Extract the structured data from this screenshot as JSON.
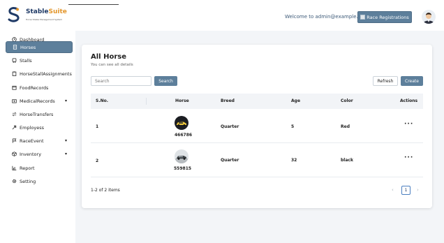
{
  "brand": {
    "name_part1": "Stable",
    "name_part2": "Suite",
    "tagline": "Horse Stable Management System"
  },
  "header": {
    "welcome_text": "Welcome to admin@example.com",
    "race_button_label": "Race Registrations"
  },
  "sidebar": {
    "items": [
      {
        "label": "Dashboard",
        "icon": "clock-icon",
        "active": false,
        "expandable": false
      },
      {
        "label": "Horses",
        "icon": "document-icon",
        "active": true,
        "expandable": false
      },
      {
        "label": "Stalls",
        "icon": "bus-icon",
        "active": false,
        "expandable": false
      },
      {
        "label": "HorseStallAssignments",
        "icon": "clipboard-icon",
        "active": false,
        "expandable": false
      },
      {
        "label": "FoodRecords",
        "icon": "calendar-icon",
        "active": false,
        "expandable": false
      },
      {
        "label": "MedicalRecords",
        "icon": "medkit-icon",
        "active": false,
        "expandable": true
      },
      {
        "label": "HorseTransfers",
        "icon": "transfer-icon",
        "active": false,
        "expandable": false
      },
      {
        "label": "Employess",
        "icon": "tools-icon",
        "active": false,
        "expandable": false
      },
      {
        "label": "RaceEvent",
        "icon": "flag-icon",
        "active": false,
        "expandable": true
      },
      {
        "label": "Inventory",
        "icon": "box-icon",
        "active": false,
        "expandable": true
      },
      {
        "label": "Report",
        "icon": "chart-icon",
        "active": false,
        "expandable": false
      },
      {
        "label": "Setting",
        "icon": "gear-icon",
        "active": false,
        "expandable": false
      }
    ]
  },
  "main": {
    "title": "All Horse",
    "subtitle": "You can see all details",
    "search_placeholder": "Search",
    "search_button": "Search",
    "refresh_button": "Refresh",
    "create_button": "Create",
    "table": {
      "headers": [
        "S.No.",
        "Horse",
        "Breed",
        "Age",
        "Color",
        "Actions"
      ],
      "rows": [
        {
          "sno": "1",
          "horse": "466786",
          "breed": "Quarter",
          "age": "5",
          "color": "Red",
          "actions": "···"
        },
        {
          "sno": "2",
          "horse": "559815",
          "breed": "Quarter",
          "age": "32",
          "color": "black",
          "actions": "···"
        }
      ]
    },
    "pagination": {
      "info": "1-2 of 2 items",
      "current_page": "1",
      "prev": "‹",
      "next": "›"
    }
  },
  "colors": {
    "accent": "#5d7f9b",
    "brand_blue": "#1f3a66",
    "brand_orange": "#e3962b",
    "page_bg": "#f3f5f8"
  }
}
